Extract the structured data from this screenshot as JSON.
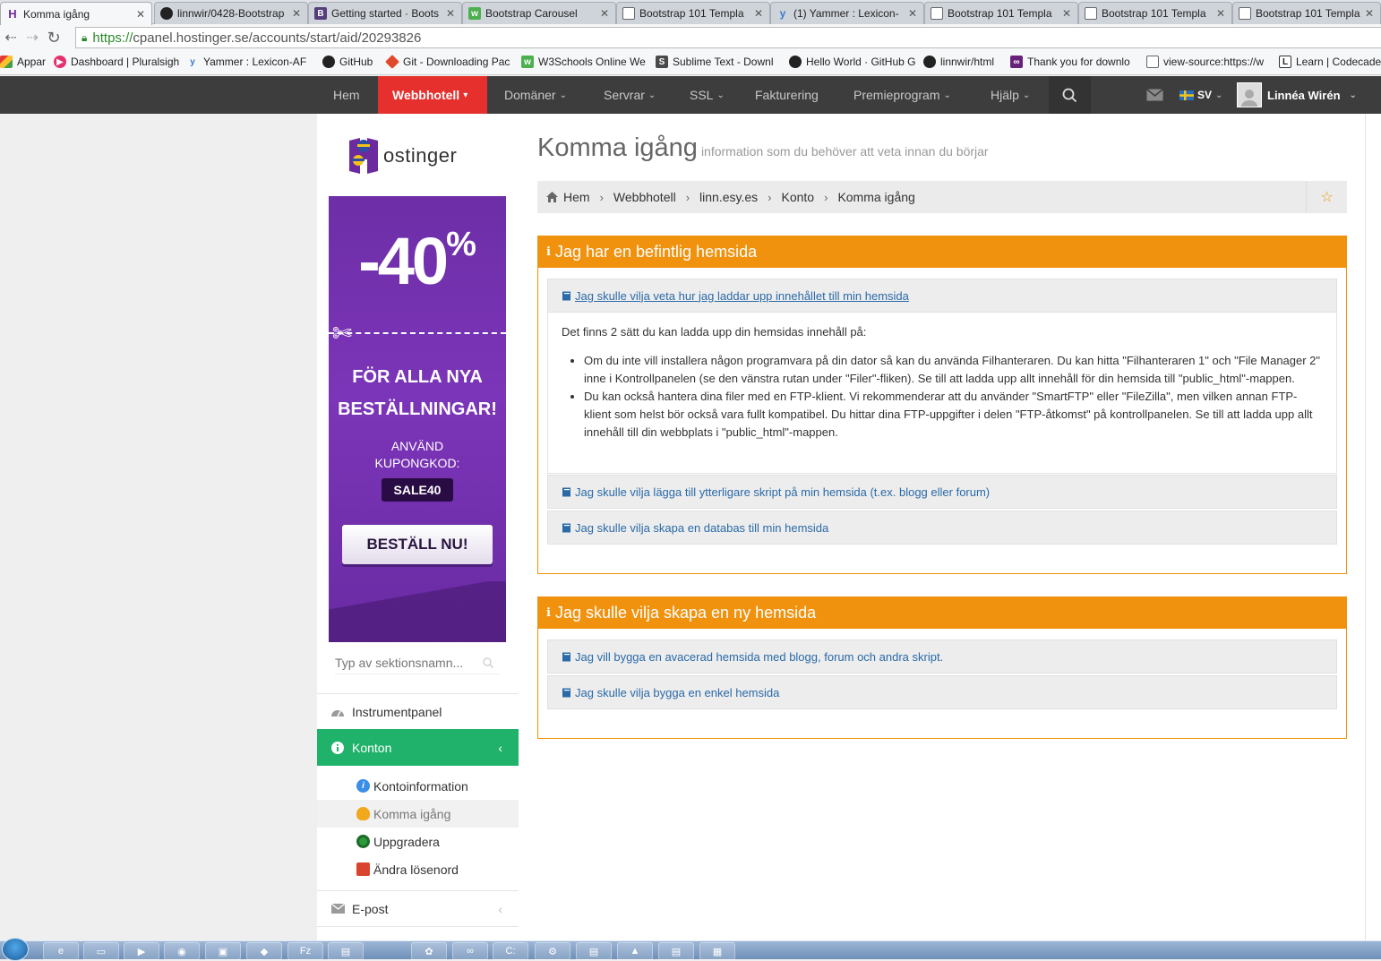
{
  "browser": {
    "tabs": [
      {
        "title": "Komma igång",
        "icon": "hostinger-favicon",
        "active": true
      },
      {
        "title": "linnwir/0428-Bootstrap",
        "icon": "github-favicon"
      },
      {
        "title": "Getting started · Boots",
        "icon": "bootstrap-favicon"
      },
      {
        "title": "Bootstrap Carousel",
        "icon": "w3schools-favicon"
      },
      {
        "title": "Bootstrap 101 Templa",
        "icon": "page-favicon"
      },
      {
        "title": "(1) Yammer : Lexicon-",
        "icon": "yammer-favicon"
      },
      {
        "title": "Bootstrap 101 Templa",
        "icon": "page-favicon"
      },
      {
        "title": "Bootstrap 101 Templa",
        "icon": "page-favicon"
      },
      {
        "title": "Bootstrap 101 Templa",
        "icon": "page-favicon"
      }
    ],
    "url_scheme": "https://",
    "url_rest": "cpanel.hostinger.se/accounts/start/aid/20293826",
    "bookmarks": [
      {
        "label": "Appar",
        "icon": "apps-icon"
      },
      {
        "label": "Dashboard | Pluralsigh",
        "icon": "pluralsight-icon"
      },
      {
        "label": "Yammer : Lexicon-AF",
        "icon": "yammer-icon"
      },
      {
        "label": "GitHub",
        "icon": "github-icon"
      },
      {
        "label": "Git - Downloading Pac",
        "icon": "git-icon"
      },
      {
        "label": "W3Schools Online We",
        "icon": "w3schools-icon"
      },
      {
        "label": "Sublime Text - Downl",
        "icon": "sublime-icon"
      },
      {
        "label": "Hello World · GitHub G",
        "icon": "github-icon"
      },
      {
        "label": "linnwir/html",
        "icon": "github-icon"
      },
      {
        "label": "Thank you for downlo",
        "icon": "visualstudio-icon"
      },
      {
        "label": "view-source:https://w",
        "icon": "page-icon"
      },
      {
        "label": "Learn | Codecader",
        "icon": "codecademy-icon"
      }
    ]
  },
  "nav": {
    "items": [
      {
        "label": "Hem",
        "dropdown": false
      },
      {
        "label": "Webbhotell",
        "dropdown": true,
        "active": true
      },
      {
        "label": "Domäner",
        "dropdown": true
      },
      {
        "label": "Servrar",
        "dropdown": true
      },
      {
        "label": "SSL",
        "dropdown": true
      },
      {
        "label": "Fakturering",
        "dropdown": false
      },
      {
        "label": "Premieprogram",
        "dropdown": true
      },
      {
        "label": "Hjälp",
        "dropdown": true
      }
    ],
    "language": "SV",
    "user_name": "Linnéa Wirén"
  },
  "sidebar": {
    "logo_text": "ostinger",
    "promo": {
      "discount": "-40",
      "percent": "%",
      "line1a": "FÖR ALLA NYA",
      "line1b": "BESTÄLLNINGAR!",
      "line2a": "ANVÄND",
      "line2b": "KUPONGKOD:",
      "code": "SALE40",
      "cta": "BESTÄLL NU!"
    },
    "search_placeholder": "Typ av sektionsnamn...",
    "menu": [
      {
        "label": "Instrumentpanel",
        "icon": "dashboard-icon"
      },
      {
        "label": "Konton",
        "icon": "info-circle-icon",
        "active": true
      },
      {
        "label": "E-post",
        "icon": "envelope-icon"
      }
    ],
    "submenu": [
      {
        "label": "Kontoinformation",
        "icon": "info-icon",
        "color": "#3a8ee6"
      },
      {
        "label": "Komma igång",
        "icon": "lightbulb-icon",
        "color": "#f2a81d",
        "current": true
      },
      {
        "label": "Uppgradera",
        "icon": "upgrade-icon",
        "color": "#2a9a3a"
      },
      {
        "label": "Ändra lösenord",
        "icon": "lock-house-icon",
        "color": "#d9442f"
      }
    ]
  },
  "main": {
    "title": "Komma igång",
    "subtitle": "information som du behöver att veta innan du börjar",
    "breadcrumb": [
      "Hem",
      "Webbhotell",
      "linn.esy.es",
      "Konto",
      "Komma igång"
    ],
    "panel1": {
      "heading": "Jag har en befintlig hemsida",
      "items": [
        "Jag skulle vilja veta hur jag laddar upp innehållet till min hemsida",
        "Jag skulle vilja lägga till ytterligare skript på min hemsida (t.ex. blogg eller forum)",
        "Jag skulle vilja skapa en databas till min hemsida"
      ],
      "body_intro": "Det finns 2 sätt du kan ladda upp din hemsidas innehåll på:",
      "body_bullets": [
        "Om du inte vill installera någon programvara på din dator så kan du använda Filhanteraren. Du kan hitta \"Filhanteraren 1\" och \"File Manager 2\" inne i Kontrollpanelen (se den vänstra rutan under \"Filer\"-fliken). Se till att ladda upp allt innehåll för din hemsida till \"public_html\"-mappen.",
        "Du kan också hantera dina filer med en FTP-klient. Vi rekommenderar att du använder \"SmartFTP\" eller \"FileZilla\", men vilken annan FTP-klient som helst bör också vara fullt kompatibel. Du hittar dina FTP-uppgifter i delen \"FTP-åtkomst\" på kontrollpanelen. Se till att ladda upp allt innehåll till din webbplats i \"public_html\"-mappen."
      ]
    },
    "panel2": {
      "heading": "Jag skulle vilja skapa en ny hemsida",
      "items": [
        "Jag vill bygga en avacerad hemsida med blogg, forum och andra skript.",
        "Jag skulle vilja bygga en enkel hemsida"
      ]
    }
  },
  "colors": {
    "nav_bg": "#3d3d3d",
    "nav_active": "#e5302d",
    "accent_orange": "#f0920e",
    "menu_active_green": "#20b26b",
    "link_blue": "#2a6aa8",
    "promo_purple": "#7b35b8"
  }
}
